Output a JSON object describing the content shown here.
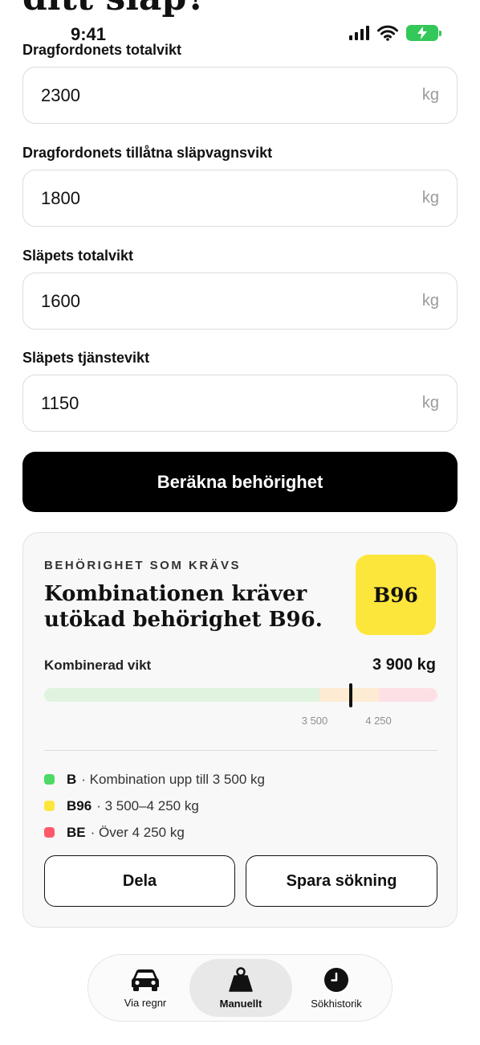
{
  "page": {
    "heading": "ditt släp?"
  },
  "status_bar": {
    "time": "9:41"
  },
  "form": {
    "fields": [
      {
        "label": "Dragfordonets totalvikt",
        "value": "2300",
        "unit": "kg"
      },
      {
        "label": "Dragfordonets tillåtna släpvagnsvikt",
        "value": "1800",
        "unit": "kg"
      },
      {
        "label": "Släpets totalvikt",
        "value": "1600",
        "unit": "kg"
      },
      {
        "label": "Släpets tjänstevikt",
        "value": "1150",
        "unit": "kg"
      }
    ],
    "submit_label": "Beräkna behörighet"
  },
  "result": {
    "eyebrow": "BEHÖRIGHET SOM KRÄVS",
    "heading": "Kombinationen kräver utökad behörighet B96.",
    "badge": "B96",
    "weight_label": "Kombinerad vikt",
    "weight_value": "3 900 kg",
    "scale": {
      "min": 0,
      "max": 5000,
      "current": 3900,
      "thresholds": [
        3500,
        4250
      ],
      "tick_labels": [
        "3 500",
        "4 250"
      ],
      "colors": {
        "b": "#dff3df",
        "b96": "#fdecd3",
        "be": "#fde0e5"
      }
    },
    "legend": [
      {
        "code": "B",
        "text": "· Kombination upp till 3 500 kg",
        "color": "#4cd964"
      },
      {
        "code": "B96",
        "text": "· 3 500–4 250 kg",
        "color": "#fde63c"
      },
      {
        "code": "BE",
        "text": "· Över 4 250 kg",
        "color": "#ff5a6a"
      }
    ],
    "share_label": "Dela",
    "save_label": "Spara sökning"
  },
  "tabs": [
    {
      "label": "Via regnr",
      "icon": "car-icon",
      "active": false
    },
    {
      "label": "Manuellt",
      "icon": "weight-icon",
      "active": true
    },
    {
      "label": "Sökhistorik",
      "icon": "clock-icon",
      "active": false
    }
  ]
}
